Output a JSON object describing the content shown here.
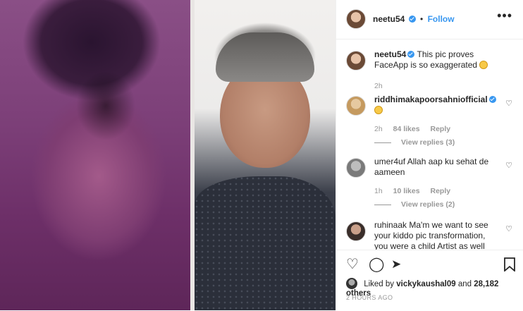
{
  "post": {
    "username": "neetu54",
    "separator": "•",
    "follow_label": "Follow",
    "more_label": "•••"
  },
  "caption": {
    "username": "neetu54",
    "text": "This pic proves FaceApp is so exaggerated",
    "time": "2h"
  },
  "comments": [
    {
      "username": "riddhimakapoorsahniofficial",
      "verified": true,
      "text": "",
      "time": "2h",
      "likes": "84 likes",
      "reply": "Reply",
      "view_replies": "View replies (3)"
    },
    {
      "username": "umer4uf",
      "verified": false,
      "text": "Allah aap ku sehat de aameen",
      "time": "1h",
      "likes": "10 likes",
      "reply": "Reply",
      "view_replies": "View replies (2)"
    },
    {
      "username": "ruhinaak",
      "verified": false,
      "text": "Ma'm we want to see your kiddo pic transformation, you were a child Artist as well"
    }
  ],
  "footer": {
    "liked_by_prefix": "Liked by",
    "liked_by_user": "vickykaushal09",
    "liked_by_suffix": "and",
    "others": "28,182 others",
    "timestamp": "2 HOURS AGO"
  },
  "icons": {
    "like": "heart-icon",
    "comment": "comment-icon",
    "share": "share-icon",
    "save": "bookmark-icon"
  },
  "colors": {
    "accent": "#3897f0",
    "text": "#262626",
    "muted": "#999999"
  }
}
